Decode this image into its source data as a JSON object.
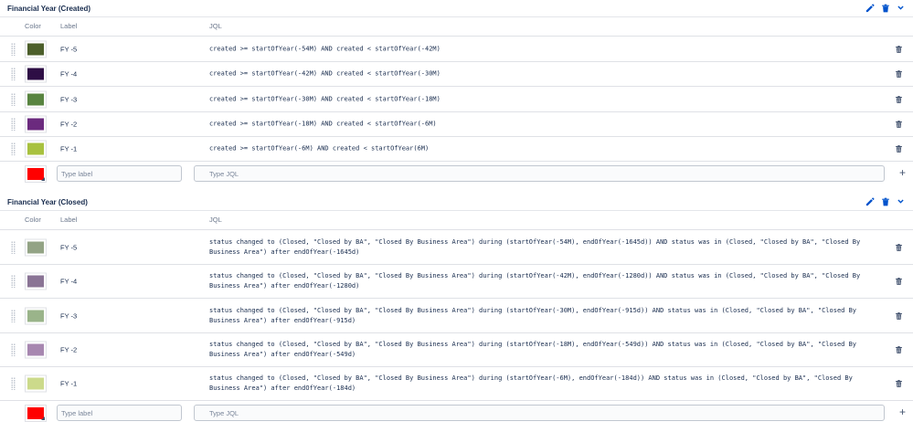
{
  "colors": {
    "new_swatch": "#ff0000",
    "icon": "#0052cc",
    "trash": "#42526e"
  },
  "sections": [
    {
      "title": "Financial Year (Created)",
      "headers": {
        "color": "Color",
        "label": "Label",
        "jql": "JQL"
      },
      "rows": [
        {
          "color": "#4b5e2a",
          "label": "FY -5",
          "jql": "created >= startOfYear(-54M) AND created < startOfYear(-42M)"
        },
        {
          "color": "#2e0e45",
          "label": "FY -4",
          "jql": "created >= startOfYear(-42M) AND created < startOfYear(-30M)"
        },
        {
          "color": "#588440",
          "label": "FY -3",
          "jql": "created >= startOfYear(-30M) AND created < startOfYear(-18M)"
        },
        {
          "color": "#6b2a7e",
          "label": "FY -2",
          "jql": "created >= startOfYear(-18M) AND created < startOfYear(-6M)"
        },
        {
          "color": "#a8c13f",
          "label": "FY -1",
          "jql": "created >= startOfYear(-6M) AND created < startOfYear(6M)"
        }
      ],
      "new_row": {
        "label_placeholder": "Type label",
        "jql_placeholder": "Type JQL"
      }
    },
    {
      "title": "Financial Year (Closed)",
      "headers": {
        "color": "Color",
        "label": "Label",
        "jql": "JQL"
      },
      "rows": [
        {
          "color": "#93a385",
          "label": "FY -5",
          "jql": "status changed to (Closed, \"Closed by BA\", \"Closed By Business Area\") during (startOfYear(-54M), endOfYear(-1645d)) AND status was in (Closed, \"Closed by BA\", \"Closed By\nBusiness Area\") after endOfYear(-1645d)"
        },
        {
          "color": "#8a7495",
          "label": "FY -4",
          "jql": "status changed to (Closed, \"Closed by BA\", \"Closed By Business Area\") during (startOfYear(-42M), endOfYear(-1280d)) AND status was in (Closed, \"Closed by BA\", \"Closed By\nBusiness Area\") after endOfYear(-1280d)"
        },
        {
          "color": "#9ab48a",
          "label": "FY -3",
          "jql": "status changed to (Closed, \"Closed by BA\", \"Closed By Business Area\") during (startOfYear(-30M), endOfYear(-915d)) AND status was in (Closed, \"Closed by BA\", \"Closed By\nBusiness Area\") after endOfYear(-915d)"
        },
        {
          "color": "#a787b0",
          "label": "FY -2",
          "jql": "status changed to (Closed, \"Closed by BA\", \"Closed By Business Area\") during (startOfYear(-18M), endOfYear(-549d)) AND status was in (Closed, \"Closed by BA\", \"Closed By\nBusiness Area\") after endOfYear(-549d)"
        },
        {
          "color": "#ccda8b",
          "label": "FY -1",
          "jql": "status changed to (Closed, \"Closed by BA\", \"Closed By Business Area\") during (startOfYear(-6M), endOfYear(-184d)) AND status was in (Closed, \"Closed by BA\", \"Closed By\nBusiness Area\") after endOfYear(-184d)"
        }
      ],
      "new_row": {
        "label_placeholder": "Type label",
        "jql_placeholder": "Type JQL"
      }
    }
  ]
}
